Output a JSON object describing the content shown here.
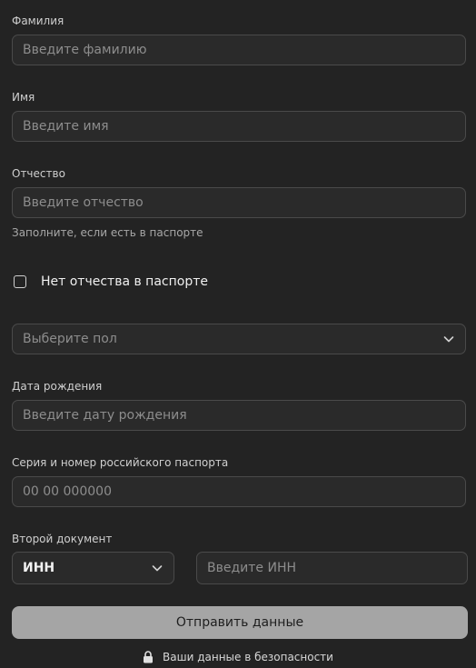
{
  "fields": {
    "last_name": {
      "label": "Фамилия",
      "placeholder": "Введите фамилию"
    },
    "first_name": {
      "label": "Имя",
      "placeholder": "Введите имя"
    },
    "patronymic": {
      "label": "Отчество",
      "placeholder": "Введите отчество",
      "hint": "Заполните, если есть в паспорте"
    },
    "no_patronymic": {
      "label": "Нет отчества в паспорте",
      "checked": false
    },
    "gender": {
      "placeholder": "Выберите пол"
    },
    "birth_date": {
      "label": "Дата рождения",
      "placeholder": "Введите дату рождения"
    },
    "passport": {
      "label": "Серия и номер российского паспорта",
      "placeholder": "00 00 000000"
    },
    "second_document": {
      "label": "Второй документ",
      "selected": "ИНН",
      "placeholder": "Введите ИНН"
    }
  },
  "submit_label": "Отправить данные",
  "security_note": "Ваши данные в безопасности",
  "icons": {
    "chevron": "chevron-down-icon",
    "lock": "lock-icon"
  },
  "colors": {
    "background": "#232323",
    "submit_bg": "#a5a5a5"
  }
}
